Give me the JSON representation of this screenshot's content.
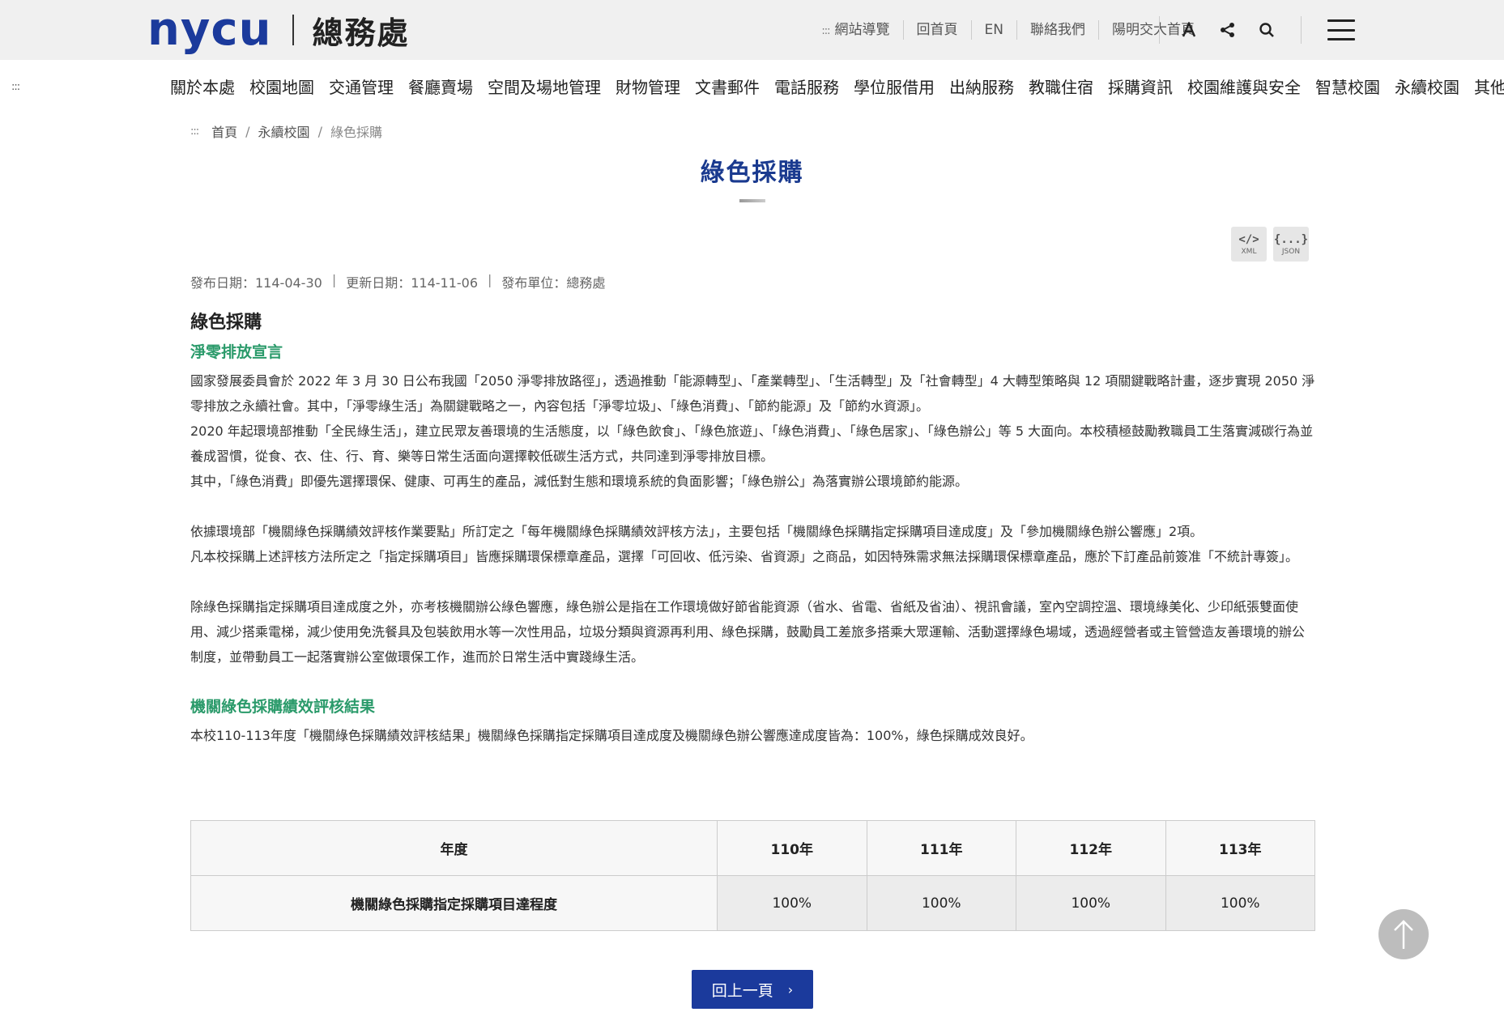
{
  "header": {
    "logo_mark": "nycu",
    "logo_text": "總務處",
    "access_key": ":::",
    "links": [
      "網站導覽",
      "回首頁",
      "EN",
      "聯絡我們",
      "陽明交大首頁"
    ],
    "icons": [
      "font-size-icon",
      "share-icon",
      "search-icon",
      "menu-icon"
    ]
  },
  "nav": {
    "access_key": ":::",
    "items": [
      "關於本處",
      "校園地圖",
      "交通管理",
      "餐廳賣場",
      "空間及場地管理",
      "財物管理",
      "文書郵件",
      "電話服務",
      "學位服借用",
      "出納服務",
      "教職住宿",
      "採購資訊",
      "校園維護與安全",
      "智慧校園",
      "永續校園",
      "其他"
    ]
  },
  "breadcrumb": {
    "access_key": ":::",
    "items": [
      "首頁",
      "永續校園",
      "綠色採購"
    ],
    "separator": "/"
  },
  "page": {
    "title": "綠色採購",
    "export_xml_symbol": "</>",
    "export_xml_label": "XML",
    "export_json_symbol": "{...}",
    "export_json_label": "JSON",
    "meta": {
      "published": "發布日期：114-04-30",
      "updated": "更新日期：114-11-06",
      "unit": "發布單位：總務處",
      "sep": "|"
    }
  },
  "content": {
    "heading": "綠色採購",
    "section1_title": "淨零排放宣言",
    "p1": "國家發展委員會於 2022 年 3 月 30 日公布我國「2050 淨零排放路徑」，透過推動「能源轉型」、「產業轉型」、「生活轉型」及「社會轉型」4 大轉型策略與 12 項關鍵戰略計畫，逐步實現 2050 淨零排放之永續社會。其中，「淨零綠生活」為關鍵戰略之一，內容包括「淨零垃圾」、「綠色消費」、「節約能源」及「節約水資源」。",
    "p2": "2020 年起環境部推動「全民綠生活」，建立民眾友善環境的生活態度，以「綠色飲食」、「綠色旅遊」、「綠色消費」、「綠色居家」、「綠色辦公」等 5 大面向。本校積極鼓勵教職員工生落實減碳行為並養成習慣，從食、衣、住、行、育、樂等日常生活面向選擇較低碳生活方式，共同達到淨零排放目標。",
    "p3": "其中，「綠色消費」即優先選擇環保、健康、可再生的產品，減低對生態和環境系統的負面影響；「綠色辦公」為落實辦公環境節約能源。",
    "p4": "依據環境部「機關綠色採購績效評核作業要點」所訂定之「每年機關綠色採購績效評核方法」，主要包括「機關綠色採購指定採購項目達成度」及「參加機關綠色辦公響應」2項。",
    "p5": "凡本校採購上述評核方法所定之「指定採購項目」皆應採購環保標章產品，選擇「可回收、低污染、省資源」之商品，如因特殊需求無法採購環保標章產品，應於下訂產品前簽准「不統計專簽」。",
    "p6": "除綠色採購指定採購項目達成度之外，亦考核機關辦公綠色響應，綠色辦公是指在工作環境做好節省能資源（省水、省電、省紙及省油）、視訊會議，室內空調控溫、環境綠美化、少印紙張雙面使用、減少搭乘電梯，減少使用免洗餐具及包裝飲用水等一次性用品，垃圾分類與資源再利用、綠色採購，鼓勵員工差旅多搭乘大眾運輸、活動選擇綠色場域，透過經營者或主管營造友善環境的辦公制度，並帶動員工一起落實辦公室做環保工作，進而於日常生活中實踐綠生活。",
    "section2_title": "機關綠色採購績效評核結果",
    "p7": "本校110-113年度「機關綠色採購績效評核結果」機關綠色採購指定採購項目達成度及機關綠色辦公響應達成度皆為：100%，綠色採購成效良好。"
  },
  "table": {
    "header_label": "年度",
    "years": [
      "110年",
      "111年",
      "112年",
      "113年"
    ],
    "row_label": "機關綠色採購指定採購項目達程度",
    "values": [
      "100%",
      "100%",
      "100%",
      "100%"
    ]
  },
  "footer": {
    "back_label": "回上一頁",
    "back_chevron": "›"
  }
}
